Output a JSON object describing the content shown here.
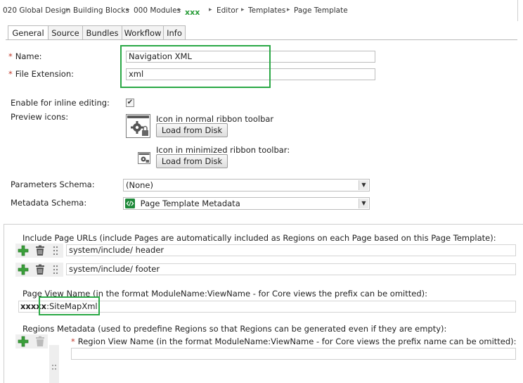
{
  "breadcrumb": {
    "items": [
      "020 Global Design",
      "Building Blocks",
      "000 Modules",
      "xxx",
      "Editor",
      "Templates",
      "Page Template"
    ]
  },
  "tabs": [
    "General",
    "Source",
    "Bundles",
    "Workflow",
    "Info"
  ],
  "form": {
    "name_label": "Name:",
    "name_value": "Navigation XML",
    "ext_label": "File Extension:",
    "ext_value": "xml",
    "required_mark": "*",
    "inline_label": "Enable for inline editing:",
    "inline_check": "✔",
    "preview_label": "Preview icons:",
    "icon_normal_label": "Icon in normal ribbon toolbar",
    "icon_min_label": "Icon in minimized ribbon toolbar:",
    "load_button": "Load from Disk",
    "params_label": "Parameters Schema:",
    "params_value": "(None)",
    "metadata_label": "Metadata Schema:",
    "metadata_value": "Page Template Metadata"
  },
  "panel": {
    "include_label": "Include Page URLs (include Pages are automatically included as Regions on each Page based on this Page Template):",
    "include_urls": [
      "system/include/  header",
      "system/include/  footer"
    ],
    "view_label": "Page View Name (in the format ModuleName:ViewName - for Core views the prefix can be omitted):",
    "view_prefix": "xxxxx",
    "view_value": ":SiteMapXml",
    "regions_label": "Regions Metadata (used to predefine Regions so that Regions can be generated even if they are empty):",
    "region_view_label": "Region View Name (in the format ModuleName:ViewName - for Core views the prefix name can be omitted):"
  },
  "colors": {
    "highlight_green": "#2aa845",
    "required_red": "#c0392b",
    "plus_green": "#3aa03a"
  }
}
